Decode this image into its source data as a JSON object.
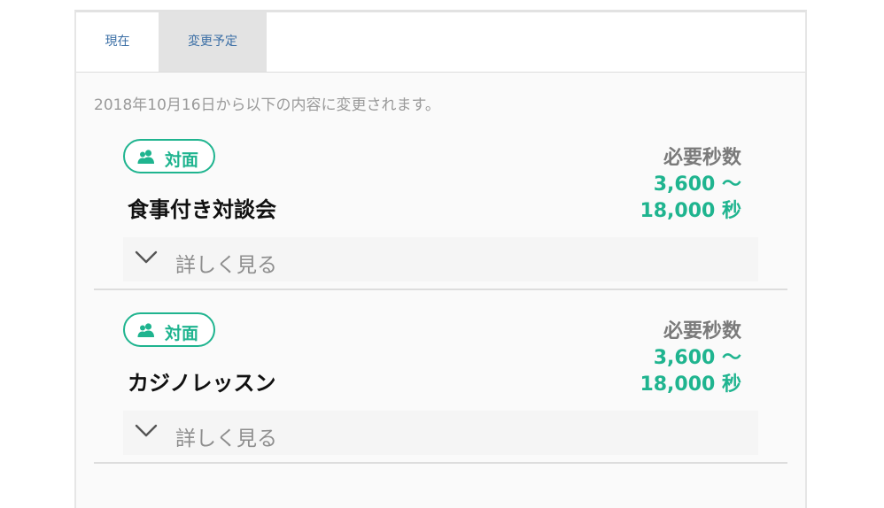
{
  "tabs": {
    "current": "現在",
    "planned": "変更予定"
  },
  "notice": "2018年10月16日から以下の内容に変更されます。",
  "items": [
    {
      "badge": "対面",
      "title": "食事付き対談会",
      "required_label": "必要秒数",
      "required_min": "3,600 〜",
      "required_max": "18,000 秒",
      "details_label": "詳しく見る"
    },
    {
      "badge": "対面",
      "title": "カジノレッスン",
      "required_label": "必要秒数",
      "required_min": "3,600 〜",
      "required_max": "18,000 秒",
      "details_label": "詳しく見る"
    }
  ],
  "colors": {
    "accent": "#1fb48f",
    "tab_text": "#3a6ea5",
    "active_tab_bg": "#e3e3e3"
  },
  "icons": {
    "badge": "people-icon",
    "details": "chevron-down-icon"
  }
}
